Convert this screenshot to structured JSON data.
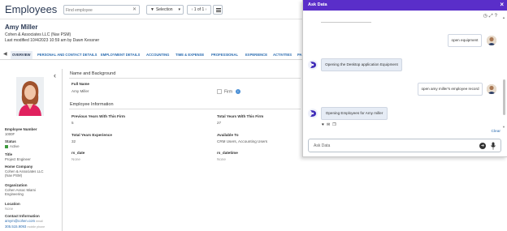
{
  "app": {
    "title": "Employees",
    "search_placeholder": "Find employee",
    "selection_label": "Selection",
    "pager_text": "1 of 1"
  },
  "record": {
    "name": "Amy Miller",
    "company": "Cohen & Associates LLC (Nav PSM)",
    "last_modified": "Last modified 10/4/2023 10:59 am by Dawn Kessner"
  },
  "tabs": [
    {
      "label": "OVERVIEW"
    },
    {
      "label": "PERSONAL AND CONTACT DETAILS"
    },
    {
      "label": "EMPLOYMENT DETAILS"
    },
    {
      "label": "ACCOUNTING"
    },
    {
      "label": "TIME & EXPENSE"
    },
    {
      "label": "PROFESSIONAL"
    },
    {
      "label": "EXPERIENCE"
    },
    {
      "label": "ACTIVITIES"
    },
    {
      "label": "PA"
    }
  ],
  "left_panel": {
    "employee_number_label": "Employee Number",
    "employee_number": "1000F",
    "status_label": "Status",
    "status": "Active",
    "title_label": "Title",
    "title": "Project Engineer",
    "home_company_label": "Home Company",
    "home_company": "Cohen & Associates LLC (Nav PSM)",
    "organization_label": "Organization",
    "organization": "Cohen Assoc Miami Engineering",
    "location_label": "Location",
    "location": "None",
    "contact_label": "Contact Information",
    "email": "amym@cohen.com",
    "email_type": "email",
    "phone": "305.515.9093",
    "phone_type": "mobile phone",
    "status_color": "#3e9b3e"
  },
  "main": {
    "name_section": "Name and Background",
    "full_name_label": "Full Name",
    "full_name": "Amy Miller",
    "firm_label": "Firm",
    "employee_info_section": "Employee Information",
    "prev_years_label": "Previous Years With This Firm",
    "prev_years": "5",
    "total_years_firm_label": "Total Years With This Firm",
    "total_years_firm": "27",
    "total_years_exp_label": "Total Years Experience",
    "total_years_exp": "32",
    "available_to_label": "Available To",
    "available_to": "CRM Users, Accounting Users",
    "rs_date_label": "rs_date",
    "rs_date": "None",
    "rs_datetime_label": "rs_datetime",
    "rs_datetime": "None"
  },
  "ask_data": {
    "title": "Ask Data",
    "header_color": "#5a2ec9",
    "messages": [
      {
        "role": "user",
        "text": "open equipment"
      },
      {
        "role": "bot",
        "text": "Opening the Desktop application Equipment"
      },
      {
        "role": "user",
        "text": "open amy miller's employee record"
      },
      {
        "role": "bot",
        "text": "Opening Employees for Amy miller"
      }
    ],
    "clear_label": "Clear",
    "input_value": "Ask Data"
  }
}
